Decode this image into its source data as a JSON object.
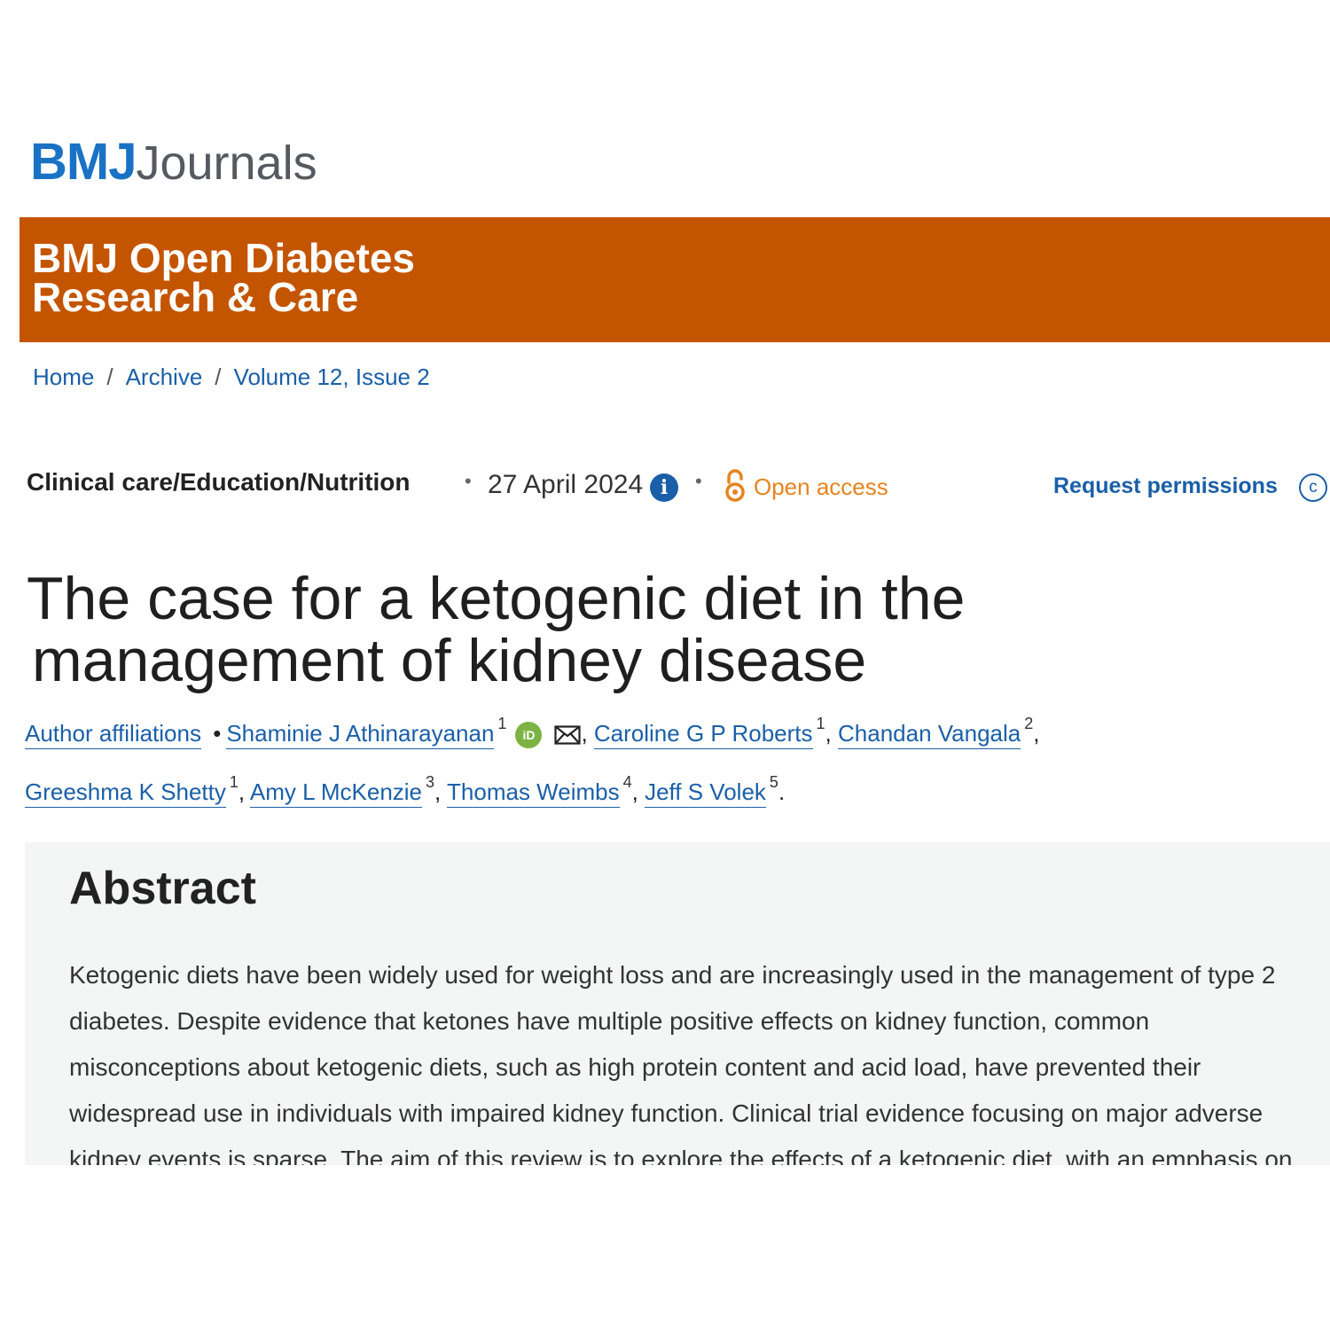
{
  "brand": {
    "logo_bmj": "BMJ",
    "logo_journals": "Journals"
  },
  "journal": {
    "line1": "BMJ Open Diabetes",
    "line2": "Research & Care"
  },
  "breadcrumb": {
    "items": [
      "Home",
      "Archive",
      "Volume 12, Issue 2"
    ],
    "separator": "/"
  },
  "meta": {
    "section": "Clinical care/Education/Nutrition",
    "dot": "•",
    "date": "27 April 2024",
    "info_icon": "info-icon",
    "open_access": "Open access",
    "request_permissions": "Request permissions",
    "copyright_icon": "copyright-icon"
  },
  "article": {
    "title_line1": "The case for a ketogenic diet in the",
    "title_line2": "management of kidney disease"
  },
  "authors": {
    "affiliations_link": "Author affiliations",
    "bullet": "•",
    "list": [
      {
        "name": "Shaminie J Athinarayanan",
        "sup": "1"
      },
      {
        "name": "Caroline G P Roberts",
        "sup": "1"
      },
      {
        "name": "Chandan Vangala",
        "sup": "2"
      },
      {
        "name": "Greeshma K Shetty",
        "sup": "1"
      },
      {
        "name": "Amy L McKenzie",
        "sup": "3"
      },
      {
        "name": "Thomas Weimbs",
        "sup": "4"
      },
      {
        "name": "Jeff S Volek",
        "sup": "5"
      }
    ],
    "orcid_label": "iD",
    "colors": {
      "link": "#1a5fa8",
      "orcid": "#7cb342"
    }
  },
  "abstract": {
    "heading": "Abstract",
    "lines": [
      "Ketogenic diets have been widely used for weight loss and are increasingly used in the management of type 2",
      "diabetes. Despite evidence that ketones have multiple positive effects on kidney function, common",
      "misconceptions about ketogenic diets, such as high protein content and acid load, have prevented their",
      "widespread use in individuals with impaired kidney function. Clinical trial evidence focusing on major adverse",
      "kidney events is sparse. The aim of this review is to explore the effects of a ketogenic diet, with an emphasis on"
    ]
  },
  "colors": {
    "brand_blue": "#1a72c4",
    "banner": "#c45500",
    "open_access": "#e6841f",
    "abstract_bg": "#f4f5f5"
  }
}
